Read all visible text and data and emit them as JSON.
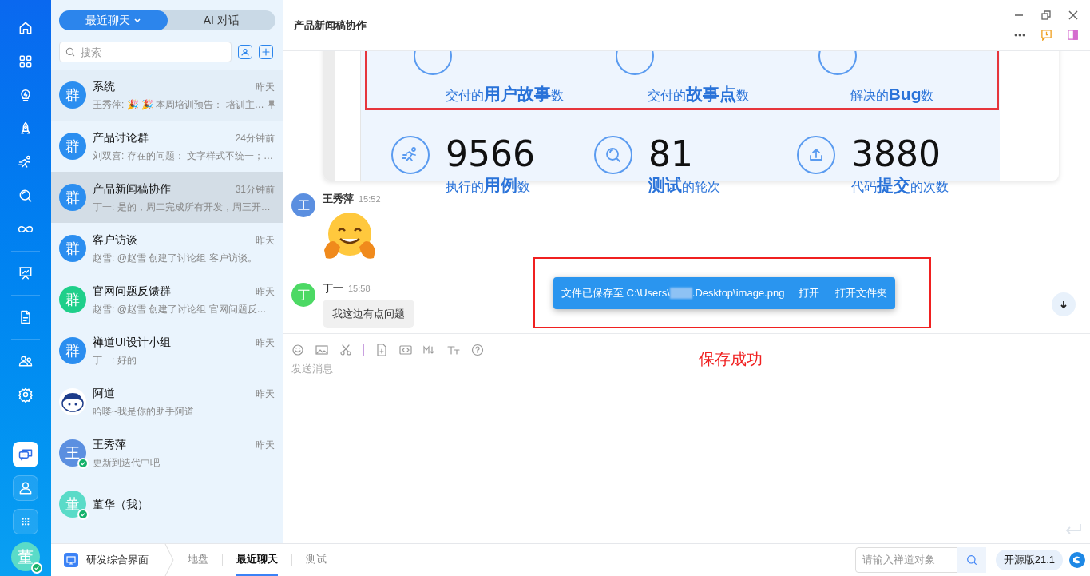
{
  "rail": {
    "items": [
      {
        "kind": "home",
        "selected": false
      },
      {
        "kind": "grid",
        "selected": false
      },
      {
        "kind": "bulb",
        "selected": false
      },
      {
        "kind": "rocket",
        "selected": false
      },
      {
        "kind": "runner",
        "selected": false
      },
      {
        "kind": "search",
        "selected": false
      },
      {
        "kind": "infinity",
        "selected": false
      },
      {
        "kind": "divider"
      },
      {
        "kind": "board",
        "selected": false
      },
      {
        "kind": "divider"
      },
      {
        "kind": "doc",
        "selected": false
      },
      {
        "kind": "divider"
      },
      {
        "kind": "people",
        "selected": false
      },
      {
        "kind": "gear",
        "selected": false
      }
    ],
    "apps": [
      {
        "kind": "chat",
        "selected": true
      },
      {
        "kind": "user",
        "selected": false
      },
      {
        "kind": "apps",
        "selected": false
      }
    ],
    "me": {
      "initial": "董",
      "online": true
    }
  },
  "sidebar": {
    "tabs": [
      {
        "label": "最近聊天",
        "selected": true,
        "dropdown": true
      },
      {
        "label": "AI 对话",
        "selected": false,
        "dropdown": false
      }
    ],
    "search": {
      "placeholder": "搜索"
    },
    "chats": [
      {
        "avatar": "群",
        "kind": "group",
        "color": "#2b8ef0",
        "name": "系统",
        "time": "昨天",
        "preview": "王秀萍: 🎉 🎉 本周培训预告： 培训主…",
        "pinned": true,
        "selected": false,
        "online": false
      },
      {
        "avatar": "群",
        "kind": "group",
        "color": "#2b8ef0",
        "name": "产品讨论群",
        "time": "24分钟前",
        "preview": "刘双喜: 存在的问题： 文字样式不统一；…",
        "pinned": false,
        "selected": false,
        "online": false
      },
      {
        "avatar": "群",
        "kind": "group",
        "color": "#2b8ef0",
        "name": "产品新闻稿协作",
        "time": "31分钟前",
        "preview": "丁一: 是的，周二完成所有开发，周三开…",
        "pinned": false,
        "selected": true,
        "online": false
      },
      {
        "avatar": "群",
        "kind": "group",
        "color": "#2b8ef0",
        "name": "客户访谈",
        "time": "昨天",
        "preview": "赵雪: @赵雪 创建了讨论组 客户访谈。",
        "pinned": false,
        "selected": false,
        "online": false
      },
      {
        "avatar": "群",
        "kind": "group",
        "color": "#1fcf8a",
        "name": "官网问题反馈群",
        "time": "昨天",
        "preview": "赵雪: @赵雪 创建了讨论组 官网问题反…",
        "pinned": false,
        "selected": false,
        "online": false
      },
      {
        "avatar": "群",
        "kind": "group",
        "color": "#2b8ef0",
        "name": "禅道UI设计小组",
        "time": "昨天",
        "preview": "丁一: 好的",
        "pinned": false,
        "selected": false,
        "online": false
      },
      {
        "kind": "robot",
        "name": "阿道",
        "time": "昨天",
        "preview": "哈喽~我是你的助手阿道",
        "pinned": false,
        "selected": false,
        "online": false
      },
      {
        "avatar": "王",
        "kind": "person",
        "color": "#5b8fe0",
        "name": "王秀萍",
        "time": "昨天",
        "preview": "更新到迭代中吧",
        "pinned": false,
        "selected": false,
        "online": true
      },
      {
        "avatar": "董",
        "kind": "person",
        "color": "#5adbc8",
        "name": "董华（我）",
        "pinned": false,
        "selected": false,
        "online": true
      }
    ]
  },
  "chat": {
    "title": "产品新闻稿协作",
    "report": {
      "top": [
        {
          "label": "交付的**用户故事**数"
        },
        {
          "label": "交付的**故事点**数"
        },
        {
          "label": "解决的**Bug**数"
        }
      ],
      "bottom": [
        {
          "value": "9566",
          "label": "执行的**用例**数"
        },
        {
          "value": "81",
          "label": "**测试**的轮次"
        },
        {
          "value": "3880",
          "label": "代码**提交**的次数"
        }
      ]
    },
    "messages": [
      {
        "avatar": "王",
        "color": "#5b8fe0",
        "sender": "王秀萍",
        "time": "15:52",
        "kind": "emoji"
      },
      {
        "avatar": "丁",
        "color": "#4cd964",
        "sender": "丁一",
        "time": "15:58",
        "kind": "text",
        "text": "我这边有点问题"
      }
    ],
    "toast": {
      "message": "文件已保存至 C:\\Users\\",
      "message_end": ".Desktop\\image.png",
      "actions": [
        "打开",
        "打开文件夹"
      ]
    },
    "annotation": "保存成功",
    "composer": {
      "placeholder": "发送消息"
    }
  },
  "bottom_bar": {
    "app": "研发综合界面",
    "tabs": [
      {
        "label": "地盘",
        "selected": false
      },
      {
        "label": "最近聊天",
        "selected": true
      },
      {
        "label": "测试",
        "selected": false
      }
    ],
    "search": {
      "placeholder": "请输入禅道对象"
    },
    "version": "开源版21.1"
  }
}
